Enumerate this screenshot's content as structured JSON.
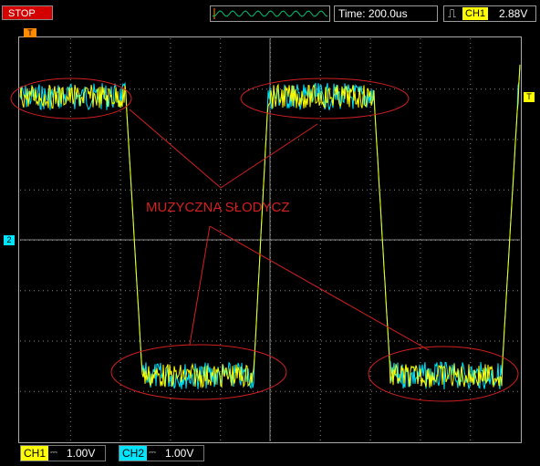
{
  "status": {
    "run_state": "STOP"
  },
  "timebase": {
    "label": "Time: 200.0us"
  },
  "trigger": {
    "channel": "CH1",
    "level": "2.88V",
    "edge_icon": "rising-edge-icon"
  },
  "markers": {
    "trigger_pos": "T",
    "ch2_ref": "2",
    "trigger_level": "T"
  },
  "annotation": {
    "text": "MUZYCZNA SŁODYCZ",
    "color": "#d42020"
  },
  "channels": [
    {
      "tag": "CH1",
      "coupling": "⎓",
      "volts": "1.00V",
      "color": "#ffff00"
    },
    {
      "tag": "CH2",
      "coupling": "⎓",
      "volts": "1.00V",
      "color": "#00e5ff"
    }
  ],
  "colors": {
    "grid": "#8a8a8a",
    "ch1": "#ffff00",
    "ch2": "#00e5ff",
    "ellipse": "#d42020"
  }
}
